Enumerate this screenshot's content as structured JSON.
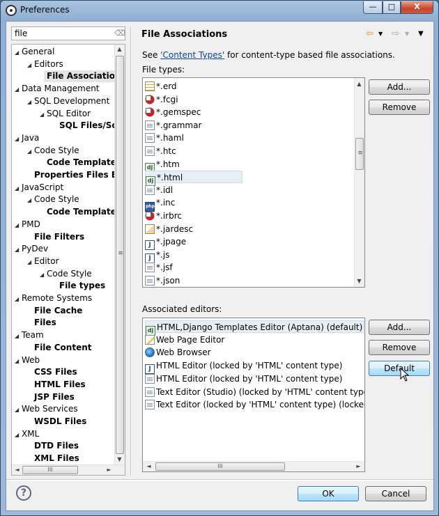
{
  "window": {
    "title": "Preferences",
    "min_glyph": "—",
    "max_glyph": "□",
    "close_glyph": "X"
  },
  "filter": {
    "value": "file"
  },
  "tree": [
    {
      "label": "General",
      "level": 0,
      "twisty": true,
      "bold": false
    },
    {
      "label": "Editors",
      "level": 1,
      "twisty": true,
      "bold": false
    },
    {
      "label": "File Associations",
      "level": 2,
      "twisty": false,
      "bold": true,
      "selected": true
    },
    {
      "label": "Data Management",
      "level": 0,
      "twisty": true,
      "bold": false
    },
    {
      "label": "SQL Development",
      "level": 1,
      "twisty": true,
      "bold": false
    },
    {
      "label": "SQL Editor",
      "level": 2,
      "twisty": true,
      "bold": false
    },
    {
      "label": "SQL Files/Scripts",
      "level": 3,
      "twisty": false,
      "bold": true
    },
    {
      "label": "Java",
      "level": 0,
      "twisty": true,
      "bold": false
    },
    {
      "label": "Code Style",
      "level": 1,
      "twisty": true,
      "bold": false
    },
    {
      "label": "Code Templates",
      "level": 2,
      "twisty": false,
      "bold": true
    },
    {
      "label": "Properties Files Editor",
      "level": 1,
      "twisty": false,
      "bold": true
    },
    {
      "label": "JavaScript",
      "level": 0,
      "twisty": true,
      "bold": false
    },
    {
      "label": "Code Style",
      "level": 1,
      "twisty": true,
      "bold": false
    },
    {
      "label": "Code Templates",
      "level": 2,
      "twisty": false,
      "bold": true
    },
    {
      "label": "PMD",
      "level": 0,
      "twisty": true,
      "bold": false
    },
    {
      "label": "File Filters",
      "level": 1,
      "twisty": false,
      "bold": true
    },
    {
      "label": "PyDev",
      "level": 0,
      "twisty": true,
      "bold": false
    },
    {
      "label": "Editor",
      "level": 1,
      "twisty": true,
      "bold": false
    },
    {
      "label": "Code Style",
      "level": 2,
      "twisty": true,
      "bold": false
    },
    {
      "label": "File types",
      "level": 3,
      "twisty": false,
      "bold": true
    },
    {
      "label": "Remote Systems",
      "level": 0,
      "twisty": true,
      "bold": false
    },
    {
      "label": "File Cache",
      "level": 1,
      "twisty": false,
      "bold": true
    },
    {
      "label": "Files",
      "level": 1,
      "twisty": false,
      "bold": true
    },
    {
      "label": "Team",
      "level": 0,
      "twisty": true,
      "bold": false
    },
    {
      "label": "File Content",
      "level": 1,
      "twisty": false,
      "bold": true
    },
    {
      "label": "Web",
      "level": 0,
      "twisty": true,
      "bold": false
    },
    {
      "label": "CSS Files",
      "level": 1,
      "twisty": false,
      "bold": true
    },
    {
      "label": "HTML Files",
      "level": 1,
      "twisty": false,
      "bold": true
    },
    {
      "label": "JSP Files",
      "level": 1,
      "twisty": false,
      "bold": true
    },
    {
      "label": "Web Services",
      "level": 0,
      "twisty": true,
      "bold": false
    },
    {
      "label": "WSDL Files",
      "level": 1,
      "twisty": false,
      "bold": true
    },
    {
      "label": "XML",
      "level": 0,
      "twisty": true,
      "bold": false
    },
    {
      "label": "DTD Files",
      "level": 1,
      "twisty": false,
      "bold": true
    },
    {
      "label": "XML Files",
      "level": 1,
      "twisty": false,
      "bold": true
    }
  ],
  "page": {
    "title": "File Associations",
    "desc_prefix": "See ",
    "desc_link": "'Content Types'",
    "desc_suffix": " for content-type based file associations.",
    "file_types_label": "File types:",
    "assoc_label": "Associated editors:"
  },
  "file_types": [
    {
      "label": "*.erd",
      "icon": "table"
    },
    {
      "label": "*.fcgi",
      "icon": "gem"
    },
    {
      "label": "*.gemspec",
      "icon": "gem"
    },
    {
      "label": "*.grammar",
      "icon": "doc"
    },
    {
      "label": "*.haml",
      "icon": "doc"
    },
    {
      "label": "*.htc",
      "icon": "doc"
    },
    {
      "label": "*.htm",
      "icon": "web"
    },
    {
      "label": "*.html",
      "icon": "web",
      "selected": true
    },
    {
      "label": "*.idl",
      "icon": "doc"
    },
    {
      "label": "*.inc",
      "icon": "php"
    },
    {
      "label": "*.irbrc",
      "icon": "gem"
    },
    {
      "label": "*.jardesc",
      "icon": "jar"
    },
    {
      "label": "*.jpage",
      "icon": "jsp"
    },
    {
      "label": "*.js",
      "icon": "jsp"
    },
    {
      "label": "*.jsf",
      "icon": "doc"
    },
    {
      "label": "*.json",
      "icon": "doc"
    }
  ],
  "editors": [
    {
      "label": "HTML,Django Templates Editor (Aptana) (default)",
      "icon": "web",
      "selected": true
    },
    {
      "label": "Web Page Editor",
      "icon": "pencil"
    },
    {
      "label": "Web Browser",
      "icon": "globe"
    },
    {
      "label": "HTML Editor (locked by 'HTML' content type)",
      "icon": "jsp"
    },
    {
      "label": "HTML Editor (locked by 'HTML' content type)",
      "icon": "doc"
    },
    {
      "label": "Text Editor (Studio) (locked by 'HTML' content type) (lo",
      "icon": "doc"
    },
    {
      "label": "Text Editor (locked by 'HTML' content type) (locked by",
      "icon": "doc"
    }
  ],
  "buttons": {
    "add": "Add...",
    "remove": "Remove",
    "add2": "Add...",
    "remove2": "Remove",
    "default": "Default",
    "ok": "OK",
    "cancel": "Cancel"
  },
  "scroll_glyphs": {
    "up": "▲",
    "down": "▼",
    "left": "◄",
    "right": "►",
    "grip_v": "≡",
    "grip_h": "III"
  },
  "nav_glyphs": {
    "back": "⇦",
    "forward": "⇨",
    "menu": "▼"
  },
  "help_glyph": "?",
  "colors": {
    "link": "#0645ad",
    "selection": "#e5e5e5"
  }
}
